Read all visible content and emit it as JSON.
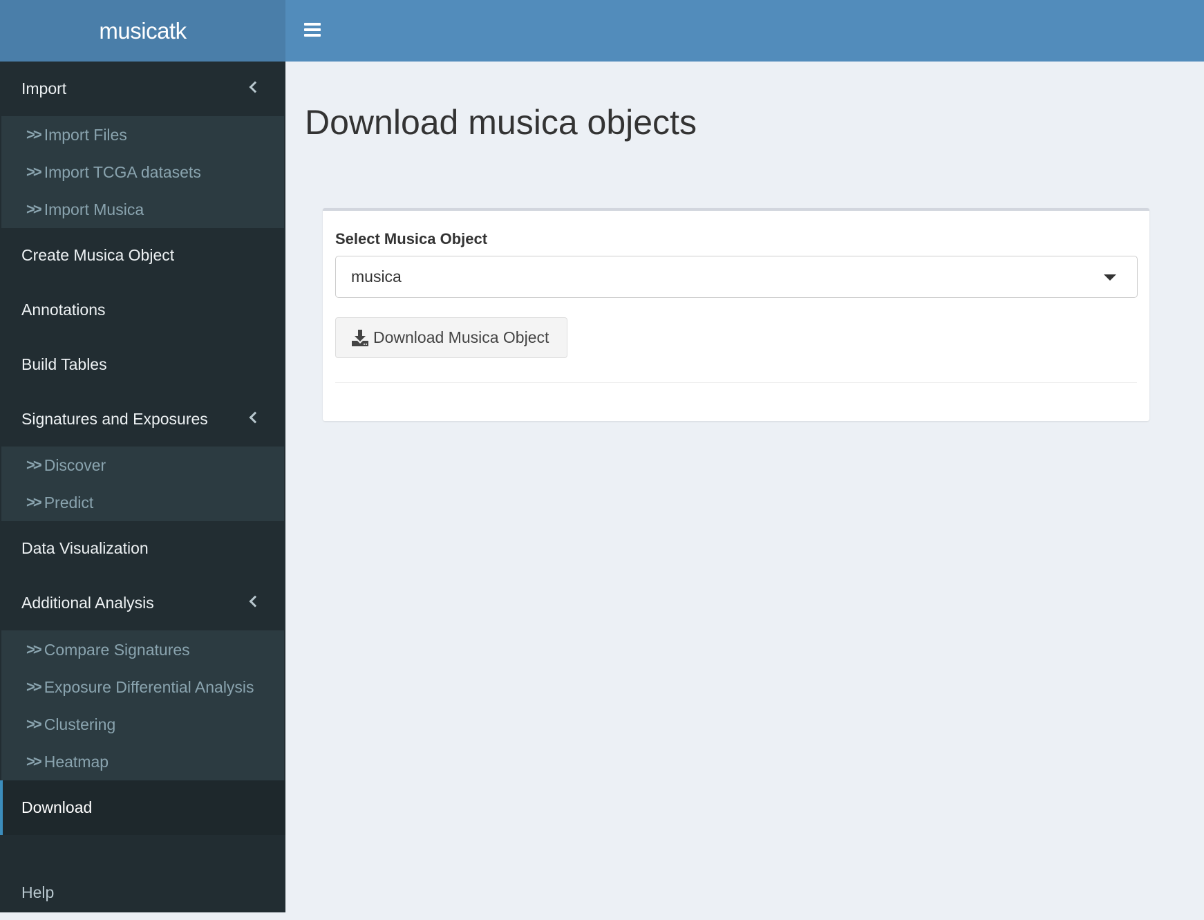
{
  "app": {
    "logo": "musicatk"
  },
  "sidebar": {
    "import": {
      "label": "Import",
      "items": [
        "Import Files",
        "Import TCGA datasets",
        "Import Musica"
      ]
    },
    "create": "Create Musica Object",
    "annotations": "Annotations",
    "build": "Build Tables",
    "signatures": {
      "label": "Signatures and Exposures",
      "items": [
        "Discover",
        "Predict"
      ]
    },
    "dataviz": "Data Visualization",
    "additional": {
      "label": "Additional Analysis",
      "items": [
        "Compare Signatures",
        "Exposure Differential Analysis",
        "Clustering",
        "Heatmap"
      ]
    },
    "download": "Download",
    "help": "Help"
  },
  "main": {
    "title": "Download musica objects",
    "select_label": "Select Musica Object",
    "select_value": "musica",
    "download_button": "Download Musica Object"
  },
  "colors": {
    "header": "#528cbb",
    "sidebar": "#222d32",
    "accent": "#3c8dbc"
  }
}
